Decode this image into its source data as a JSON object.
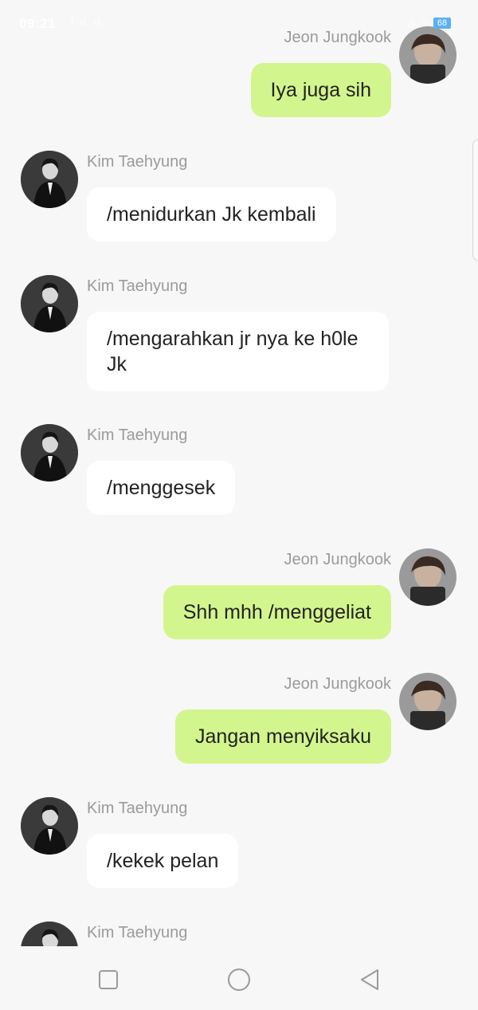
{
  "status_bar": {
    "time": "09:21",
    "signal": "ᵀ·ıl ·ıl",
    "icons": [
      "alarm-icon",
      "wifi-icon",
      "battery-icon"
    ],
    "battery": "68"
  },
  "messages": [
    {
      "sender": "Jeon Jungkook",
      "side": "out",
      "text": "Iya juga sih"
    },
    {
      "sender": "Kim Taehyung",
      "side": "in",
      "text": "/menidurkan Jk kembali"
    },
    {
      "sender": "Kim Taehyung",
      "side": "in",
      "text": "/mengarahkan jr nya ke h0le Jk"
    },
    {
      "sender": "Kim Taehyung",
      "side": "in",
      "text": "/menggesek"
    },
    {
      "sender": "Jeon Jungkook",
      "side": "out",
      "text": "Shh mhh /menggeliat"
    },
    {
      "sender": "Jeon Jungkook",
      "side": "out",
      "text": "Jangan menyiksaku"
    },
    {
      "sender": "Kim Taehyung",
      "side": "in",
      "text": "/kekek pelan"
    },
    {
      "sender": "Kim Taehyung",
      "side": "in",
      "text": ""
    }
  ],
  "colors": {
    "background": "#f7f7f7",
    "incoming_bubble": "#ffffff",
    "outgoing_bubble": "#d3f58e",
    "sender_name": "#9b9b9b",
    "message_text": "#222222"
  },
  "navbar": {
    "icons": [
      "recent-apps-icon",
      "home-icon",
      "back-icon"
    ]
  }
}
